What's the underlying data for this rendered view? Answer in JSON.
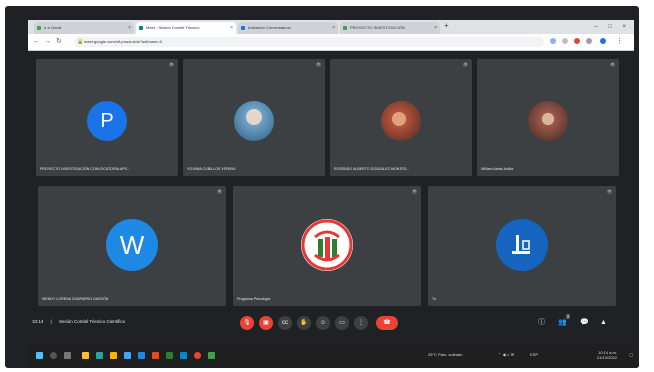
{
  "browser": {
    "tabs": [
      {
        "label": "Ir a Gmail",
        "active": false,
        "favicon_color": "#34a853"
      },
      {
        "label": "Meet - Sesión Comité Técnico",
        "active": true,
        "favicon_color": "#00897b"
      },
      {
        "label": "Invitación Conversatorio",
        "active": false,
        "favicon_color": "#1a73e8"
      },
      {
        "label": "PROYECTO INVESTIGACIÓN",
        "active": false,
        "favicon_color": "#34a853"
      }
    ],
    "new_tab_icon": "plus-icon",
    "url": "meet.google.com/nif-pmzw-bdz?authuser=0"
  },
  "participants": [
    {
      "name": "PROYECTO INVESTIGACIÓN CONVOCATORIA APS...",
      "avatar_letter": "P",
      "avatar_color": "#1a73e8",
      "avatar_type": "letter"
    },
    {
      "name": "YOVANA CUBILLOS YEPARA",
      "avatar_letter": "",
      "avatar_color": "#6fa3c8",
      "avatar_type": "photo"
    },
    {
      "name": "ROSENDO ALBERTO GONZALEZ MONTES...",
      "avatar_letter": "",
      "avatar_color": "#b8533c",
      "avatar_type": "photo"
    },
    {
      "name": "William Alexis Ardila",
      "avatar_letter": "",
      "avatar_color": "#a0584a",
      "avatar_type": "photo"
    },
    {
      "name": "WENDY LORENA CHAPARRO GARZÓN",
      "avatar_letter": "W",
      "avatar_color": "#1e88e5",
      "avatar_type": "letter"
    },
    {
      "name": "Programa Psicología",
      "avatar_letter": "",
      "avatar_color": "#ffffff",
      "avatar_type": "logo"
    },
    {
      "name": "Tú",
      "avatar_letter": "",
      "avatar_color": "#1565c0",
      "avatar_type": "photo"
    }
  ],
  "bottombar": {
    "time": "10:14",
    "meeting_title": "Sesión Comité Técnico Científico",
    "controls": [
      "mic-icon",
      "camera-icon",
      "captions-icon",
      "raise-hand-icon",
      "emoji-icon",
      "present-icon",
      "more-icon"
    ],
    "leave_icon": "hang-up-icon",
    "right_controls": [
      "info-icon",
      "people-icon",
      "chat-icon",
      "activities-icon"
    ],
    "people_count": "7"
  },
  "taskbar": {
    "weather": "25°C Parc. soleado",
    "time": "10:14 a.m.",
    "date": "21/10/2022",
    "language": "ESP"
  },
  "colors": {
    "meet_bg": "#202124",
    "tile_bg": "#3c4043",
    "danger": "#ea4335",
    "accent": "#1a73e8"
  }
}
